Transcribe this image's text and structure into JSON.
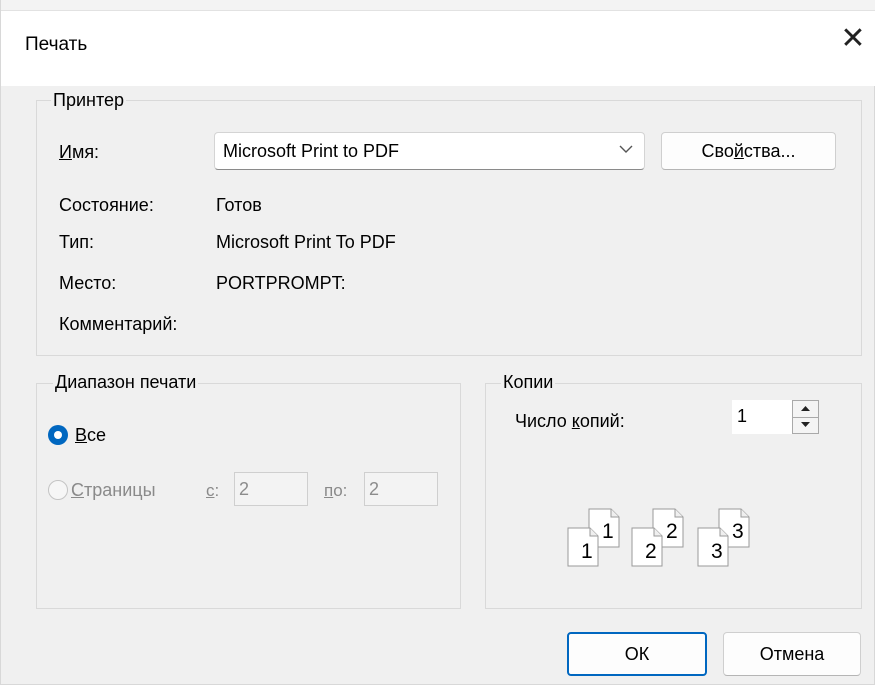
{
  "dialog": {
    "title": "Печать",
    "close_glyph": "✕"
  },
  "printer": {
    "legend": "Принтер",
    "name_label": "Имя:",
    "name_value": "Microsoft Print to PDF",
    "properties_button": "Свойства...",
    "status_label": "Состояние:",
    "status_value": "Готов",
    "type_label": "Тип:",
    "type_value": "Microsoft Print To PDF",
    "location_label": "Место:",
    "location_value": "PORTPROMPT:",
    "comment_label": "Комментарий:",
    "comment_value": ""
  },
  "range": {
    "legend": "Диапазон печати",
    "all_label": "Все",
    "pages_label": "Страницы",
    "from_label": "с:",
    "from_value": "2",
    "to_label": "по:",
    "to_value": "2",
    "selected": "all"
  },
  "copies": {
    "legend": "Копии",
    "count_label": "Число копий:",
    "count_value": "1",
    "collate_sets": [
      {
        "back": "1",
        "front": "1"
      },
      {
        "back": "2",
        "front": "2"
      },
      {
        "back": "3",
        "front": "3"
      }
    ]
  },
  "buttons": {
    "ok": "ОК",
    "cancel": "Отмена"
  },
  "colors": {
    "accent": "#0067c0",
    "dialog_bg": "#f0f0f0",
    "group_border": "#d9d9d9"
  },
  "icons": {
    "close": "close-icon",
    "dropdown": "chevron-down-icon",
    "spin_up": "arrow-up-icon",
    "spin_down": "arrow-down-icon",
    "collate": "collate-pages-icon"
  }
}
